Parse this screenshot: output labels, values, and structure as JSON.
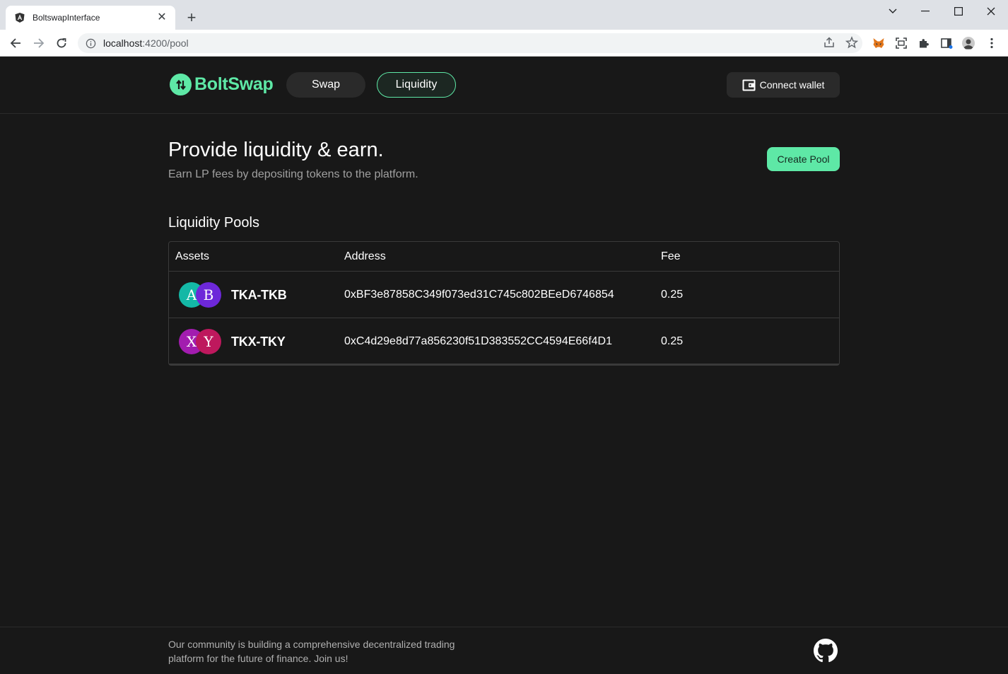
{
  "browser": {
    "tab_title": "BoltswapInterface",
    "url_host": "localhost",
    "url_path": ":4200/pool"
  },
  "header": {
    "logo_text": "BoltSwap",
    "nav": {
      "swap": "Swap",
      "liquidity": "Liquidity"
    },
    "connect_wallet": "Connect wallet"
  },
  "hero": {
    "title": "Provide liquidity & earn.",
    "subtitle": "Earn LP fees by depositing tokens to the platform.",
    "create_pool": "Create Pool"
  },
  "pools": {
    "section_title": "Liquidity Pools",
    "columns": {
      "assets": "Assets",
      "address": "Address",
      "fee": "Fee"
    },
    "rows": [
      {
        "token_a": "A",
        "token_b": "B",
        "color_a": "#14b8a6",
        "color_b": "#6d28d9",
        "name": "TKA-TKB",
        "address": "0xBF3e87858C349f073ed31C745c802BEeD6746854",
        "fee": "0.25"
      },
      {
        "token_a": "X",
        "token_b": "Y",
        "color_a": "#a21caf",
        "color_b": "#be185d",
        "name": "TKX-TKY",
        "address": "0xC4d29e8d77a856230f51D383552CC4594E66f4D1",
        "fee": "0.25"
      }
    ]
  },
  "footer": {
    "text": "Our community is building a comprehensive decentralized trading platform for the future of finance. Join us!"
  },
  "colors": {
    "accent": "#5ee8a6",
    "background": "#181818"
  }
}
